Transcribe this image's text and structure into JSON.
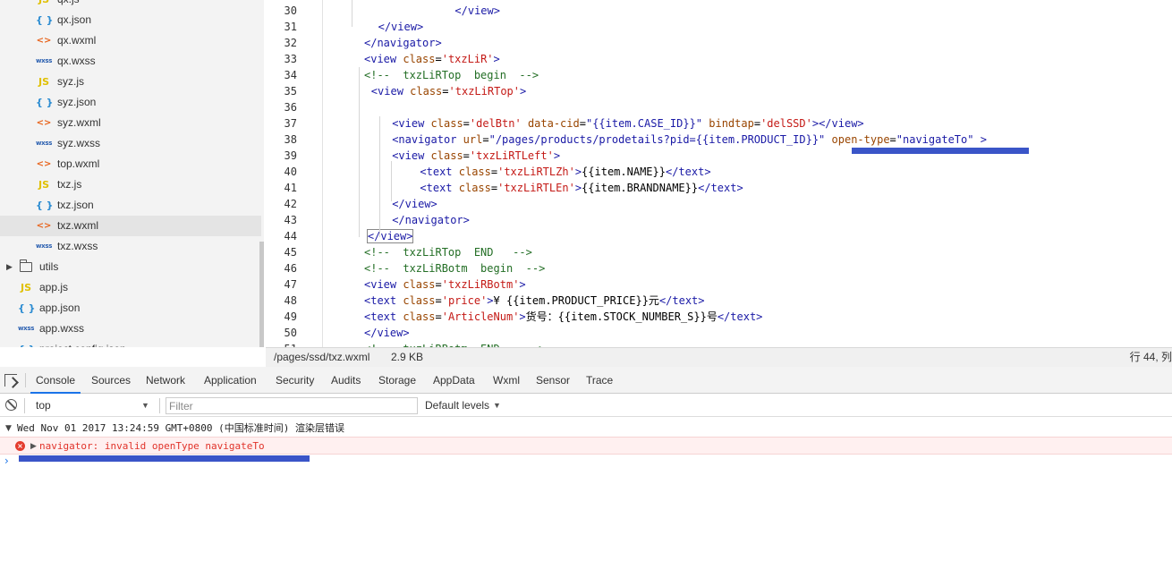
{
  "file_tree": {
    "items": [
      {
        "name": "qx.js",
        "type": "js",
        "icon": "JS"
      },
      {
        "name": "qx.json",
        "type": "json",
        "icon": "{ }"
      },
      {
        "name": "qx.wxml",
        "type": "wxml",
        "icon": "<>"
      },
      {
        "name": "qx.wxss",
        "type": "wxss",
        "icon": "wxss"
      },
      {
        "name": "syz.js",
        "type": "js",
        "icon": "JS"
      },
      {
        "name": "syz.json",
        "type": "json",
        "icon": "{ }"
      },
      {
        "name": "syz.wxml",
        "type": "wxml",
        "icon": "<>"
      },
      {
        "name": "syz.wxss",
        "type": "wxss",
        "icon": "wxss"
      },
      {
        "name": "top.wxml",
        "type": "wxml",
        "icon": "<>"
      },
      {
        "name": "txz.js",
        "type": "js",
        "icon": "JS"
      },
      {
        "name": "txz.json",
        "type": "json",
        "icon": "{ }"
      },
      {
        "name": "txz.wxml",
        "type": "wxml",
        "icon": "<>",
        "selected": true
      },
      {
        "name": "txz.wxss",
        "type": "wxss",
        "icon": "wxss"
      },
      {
        "name": "utils",
        "type": "folder",
        "icon": "folder"
      },
      {
        "name": "app.js",
        "type": "js",
        "icon": "JS"
      },
      {
        "name": "app.json",
        "type": "json",
        "icon": "{ }"
      },
      {
        "name": "app.wxss",
        "type": "wxss",
        "icon": "wxss"
      },
      {
        "name": "project.config.json",
        "type": "json",
        "icon": "{ }"
      }
    ]
  },
  "editor": {
    "line_numbers": [
      "30",
      "31",
      "32",
      "33",
      "34",
      "35",
      "36",
      "37",
      "38",
      "39",
      "40",
      "41",
      "42",
      "43",
      "44",
      "45",
      "46",
      "47",
      "48",
      "49",
      "50",
      "51"
    ],
    "lines": [
      {
        "parts": [
          {
            "k": "t",
            "v": "</view>"
          }
        ]
      },
      {
        "parts": [
          {
            "k": "t",
            "v": "</view>"
          }
        ]
      },
      {
        "parts": [
          {
            "k": "t",
            "v": "</navigator>"
          }
        ]
      },
      {
        "parts": [
          {
            "k": "t",
            "v": "<view "
          },
          {
            "k": "a",
            "v": "class"
          },
          {
            "k": "x",
            "v": "="
          },
          {
            "k": "sq",
            "v": "'txzLiR'"
          },
          {
            "k": "t",
            "v": ">"
          }
        ]
      },
      {
        "parts": [
          {
            "k": "c",
            "v": "<!--  txzLiRTop  begin  -->"
          }
        ]
      },
      {
        "parts": [
          {
            "k": "t",
            "v": "<view "
          },
          {
            "k": "a",
            "v": "class"
          },
          {
            "k": "x",
            "v": "="
          },
          {
            "k": "sq",
            "v": "'txzLiRTop'"
          },
          {
            "k": "t",
            "v": ">"
          }
        ]
      },
      {
        "parts": []
      },
      {
        "parts": [
          {
            "k": "t",
            "v": "<view "
          },
          {
            "k": "a",
            "v": "class"
          },
          {
            "k": "x",
            "v": "="
          },
          {
            "k": "sq",
            "v": "'delBtn'"
          },
          {
            "k": "x",
            "v": " "
          },
          {
            "k": "a",
            "v": "data-cid"
          },
          {
            "k": "x",
            "v": "="
          },
          {
            "k": "s",
            "v": "\"{{item.CASE_ID}}\""
          },
          {
            "k": "x",
            "v": " "
          },
          {
            "k": "a",
            "v": "bindtap"
          },
          {
            "k": "x",
            "v": "="
          },
          {
            "k": "sq",
            "v": "'delSSD'"
          },
          {
            "k": "t",
            "v": "></view>"
          }
        ]
      },
      {
        "parts": [
          {
            "k": "t",
            "v": "<navigator "
          },
          {
            "k": "a",
            "v": "url"
          },
          {
            "k": "x",
            "v": "="
          },
          {
            "k": "s",
            "v": "\"/pages/products/prodetails?pid={{item.PRODUCT_ID}}\""
          },
          {
            "k": "x",
            "v": " "
          },
          {
            "k": "a",
            "v": "open-type"
          },
          {
            "k": "x",
            "v": "="
          },
          {
            "k": "s",
            "v": "\"navigateTo\""
          },
          {
            "k": "t",
            "v": " >"
          }
        ]
      },
      {
        "parts": [
          {
            "k": "t",
            "v": "<view "
          },
          {
            "k": "a",
            "v": "class"
          },
          {
            "k": "x",
            "v": "="
          },
          {
            "k": "sq",
            "v": "'txzLiRTLeft'"
          },
          {
            "k": "t",
            "v": ">"
          }
        ]
      },
      {
        "parts": [
          {
            "k": "t",
            "v": "<text "
          },
          {
            "k": "a",
            "v": "class"
          },
          {
            "k": "x",
            "v": "="
          },
          {
            "k": "sq",
            "v": "'txzLiRTLZh'"
          },
          {
            "k": "t",
            "v": ">"
          },
          {
            "k": "x",
            "v": "{{item.NAME}}"
          },
          {
            "k": "t",
            "v": "</text>"
          }
        ]
      },
      {
        "parts": [
          {
            "k": "t",
            "v": "<text "
          },
          {
            "k": "a",
            "v": "class"
          },
          {
            "k": "x",
            "v": "="
          },
          {
            "k": "sq",
            "v": "'txzLiRTLEn'"
          },
          {
            "k": "t",
            "v": ">"
          },
          {
            "k": "x",
            "v": "{{item.BRANDNAME}}"
          },
          {
            "k": "t",
            "v": "</text>"
          }
        ]
      },
      {
        "parts": [
          {
            "k": "t",
            "v": "</view>"
          }
        ]
      },
      {
        "parts": [
          {
            "k": "t",
            "v": "</navigator>"
          }
        ]
      },
      {
        "parts": [
          {
            "k": "t",
            "v": "</view>"
          }
        ]
      },
      {
        "parts": [
          {
            "k": "c",
            "v": "<!--  txzLiRTop  END   -->"
          }
        ]
      },
      {
        "parts": [
          {
            "k": "c",
            "v": "<!--  txzLiRBotm  begin  -->"
          }
        ]
      },
      {
        "parts": [
          {
            "k": "t",
            "v": "<view "
          },
          {
            "k": "a",
            "v": "class"
          },
          {
            "k": "x",
            "v": "="
          },
          {
            "k": "sq",
            "v": "'txzLiRBotm'"
          },
          {
            "k": "t",
            "v": ">"
          }
        ]
      },
      {
        "parts": [
          {
            "k": "t",
            "v": "<text "
          },
          {
            "k": "a",
            "v": "class"
          },
          {
            "k": "x",
            "v": "="
          },
          {
            "k": "sq",
            "v": "'price'"
          },
          {
            "k": "t",
            "v": ">"
          },
          {
            "k": "x",
            "v": "¥ {{item.PRODUCT_PRICE}}元"
          },
          {
            "k": "t",
            "v": "</text>"
          }
        ]
      },
      {
        "parts": [
          {
            "k": "t",
            "v": "<text "
          },
          {
            "k": "a",
            "v": "class"
          },
          {
            "k": "x",
            "v": "="
          },
          {
            "k": "sq",
            "v": "'ArticleNum'"
          },
          {
            "k": "t",
            "v": ">"
          },
          {
            "k": "x",
            "v": "货号：{{item.STOCK_NUMBER_S}}号"
          },
          {
            "k": "t",
            "v": "</text>"
          }
        ]
      },
      {
        "parts": [
          {
            "k": "t",
            "v": "</view>"
          }
        ]
      },
      {
        "parts": [
          {
            "k": "c",
            "v": "<!--  txzLiRBotm  END    -->"
          }
        ]
      }
    ]
  },
  "status_bar": {
    "path": "/pages/ssd/txz.wxml",
    "size": "2.9 KB",
    "position": "行 44, 列"
  },
  "devtools": {
    "tabs": [
      "Console",
      "Sources",
      "Network",
      "Application",
      "Security",
      "Audits",
      "Storage",
      "AppData",
      "Wxml",
      "Sensor",
      "Trace"
    ],
    "active_tab": "Console",
    "context": "top",
    "filter_placeholder": "Filter",
    "levels": "Default levels",
    "log": {
      "group_text": "Wed Nov 01 2017 13:24:59 GMT+0800 (中国标准时间) 渲染层错误",
      "error_text": "navigator: invalid openType navigateTo",
      "prompt": "›"
    }
  },
  "colors": {
    "annotation": "#3a55c8",
    "error_text": "#e1332a",
    "error_bg": "#fff0f0",
    "active_tab_underline": "#1a73e8"
  }
}
